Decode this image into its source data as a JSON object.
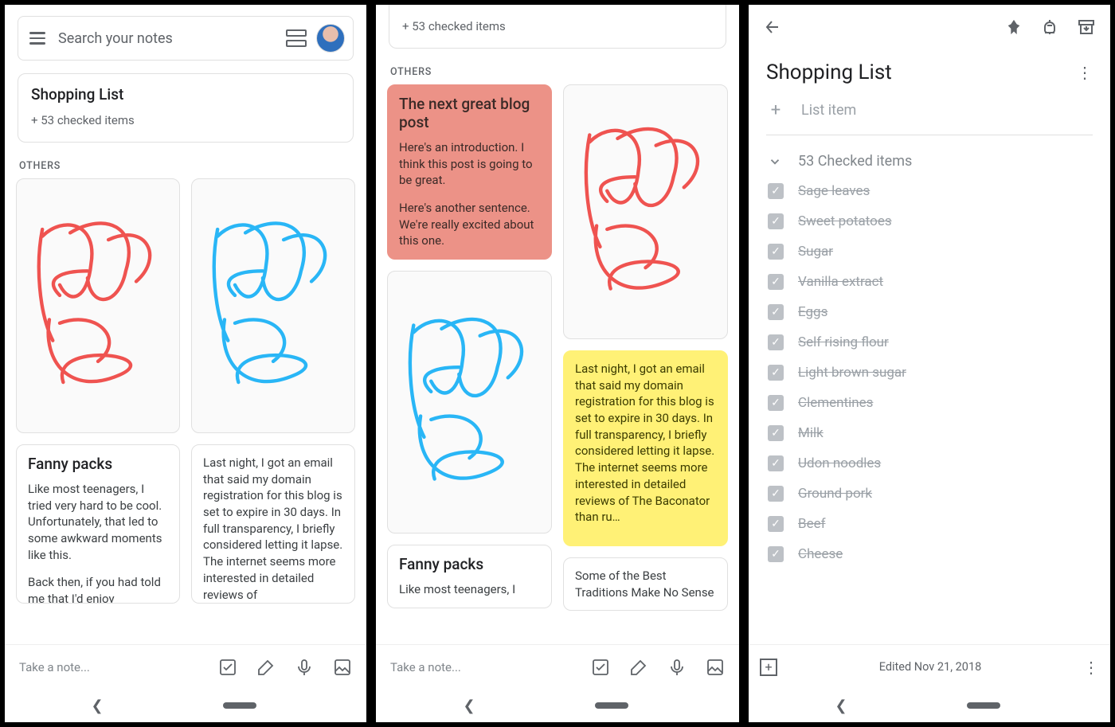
{
  "panel1": {
    "searchPlaceholder": "Search your notes",
    "pinned": {
      "title": "Shopping List",
      "subtitle": "+ 53 checked items"
    },
    "sectionLabel": "OTHERS",
    "notes": {
      "fanny": {
        "title": "Fanny packs",
        "p1": "Like most teenagers, I tried very hard to be cool. Unfortunately, that led to some awkward moments like this.",
        "p2": "Back then, if you had told me that I'd enjoy"
      },
      "domain": {
        "body": "Last night, I got an email that said my domain registration for this blog is set to expire in 30 days. In full transparency, I briefly considered letting it lapse. The internet seems more interested in detailed reviews of"
      }
    },
    "takeNote": "Take a note..."
  },
  "panel2": {
    "pinnedSub": "+ 53 checked items",
    "sectionLabel": "OTHERS",
    "blog": {
      "title": "The next great blog post",
      "p1": "Here's an introduction. I think this post is going to be great.",
      "p2": "Here's another sentence. We're really excited about this one."
    },
    "domain": "Last night, I got an email that said my domain registration for this blog is set to expire in 30 days. In full transparency, I briefly considered letting it lapse. The internet seems more interested in detailed reviews of The Baconator than ru…",
    "fannyTitle": "Fanny packs",
    "fannyBody": "Like most teenagers, I",
    "traditions": "Some of the Best Traditions Make No Sense",
    "takeNote": "Take a note..."
  },
  "panel3": {
    "title": "Shopping List",
    "addItem": "List item",
    "checkedHeader": "53 Checked items",
    "items": [
      "Sage leaves",
      "Sweet potatoes",
      "Sugar",
      "Vanilla extract",
      "Eggs",
      "Self rising flour",
      "Light brown sugar",
      "Clementines",
      "Milk",
      "Udon noodles",
      "Ground pork",
      "Beef",
      "Cheese"
    ],
    "edited": "Edited Nov 21, 2018"
  }
}
